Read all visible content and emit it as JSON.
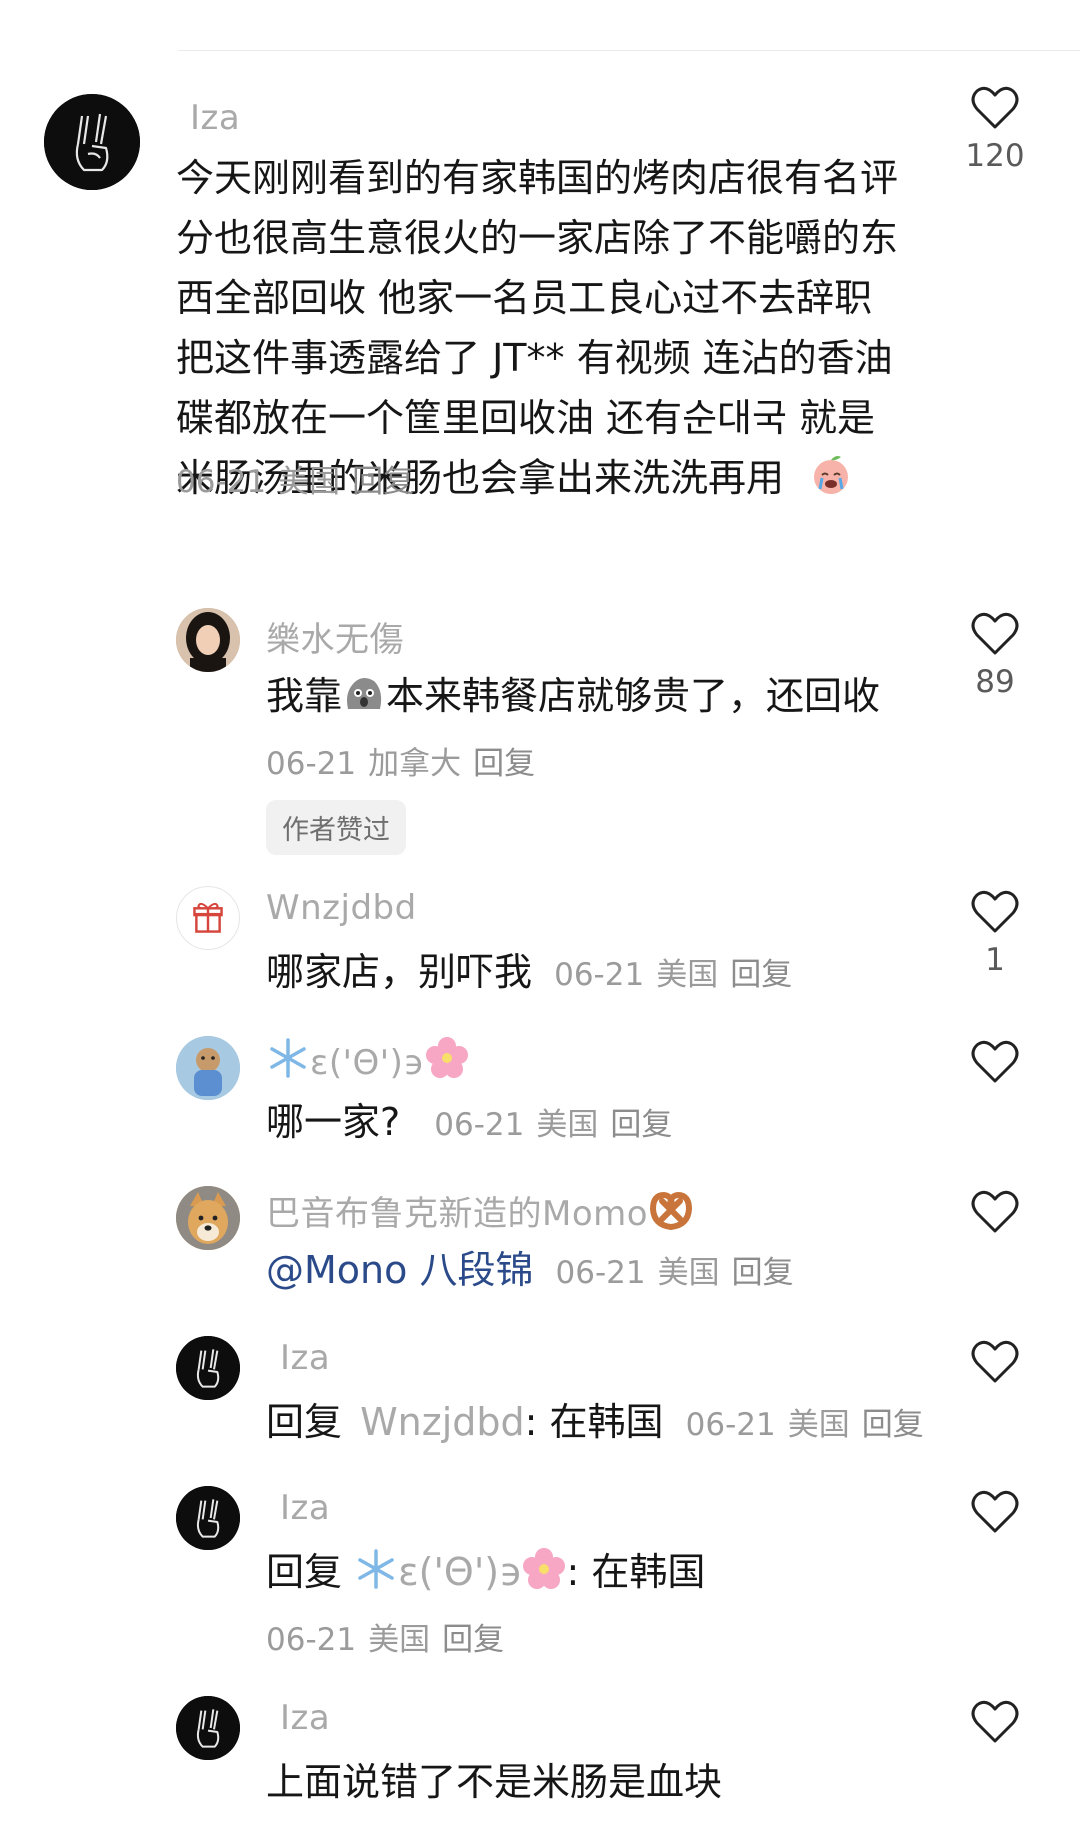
{
  "comments": [
    {
      "user": "Iza",
      "lines": [
        "今天刚刚看到的有家韩国的烤肉店很有名评",
        "分也很高生意很火的一家店除了不能嚼的东",
        "西全部回收 他家一名员工良心过不去辞职",
        "把这件事透露给了 JT** 有视频 连沾的香油",
        "碟都放在一个筐里回收油 还有순대국 就是",
        "米肠汤里的米肠也会拿出来洗洗再用"
      ],
      "date": "06-21",
      "location": "美国",
      "reply": "回复",
      "likes": "120"
    },
    {
      "user": "樂水无傷",
      "text_before": "我靠",
      "text_after": "本来韩餐店就够贵了，还回收",
      "date": "06-21",
      "location": "加拿大",
      "reply": "回复",
      "badge": "作者赞过",
      "likes": "89"
    },
    {
      "user": "Wnzjdbd",
      "text": "哪家店，别吓我",
      "date": "06-21",
      "location": "美国",
      "reply": "回复",
      "likes": "1"
    },
    {
      "user_mid": "ɛ('Θ')϶",
      "text": "哪一家?",
      "date": "06-21",
      "location": "美国",
      "reply": "回复"
    },
    {
      "user": "巴音布鲁克新造的Momo",
      "mention": "@Mono 八段锦",
      "date": "06-21",
      "location": "美国",
      "reply": "回复"
    },
    {
      "user": "Iza",
      "prefix": "回复",
      "reply_to": "Wnzjdbd",
      "text": ": 在韩国",
      "date": "06-21",
      "location": "美国",
      "reply": "回复"
    },
    {
      "user": "Iza",
      "prefix": "回复",
      "reply_to_mid": "ɛ('Θ')϶",
      "text": ": 在韩国",
      "date": "06-21",
      "location": "美国",
      "reply": "回复"
    },
    {
      "user": "Iza",
      "text": "上面说错了不是米肠是血块"
    }
  ],
  "icons": {
    "like": "heart-outline-icon",
    "avatar_iza": "peace-hand-icon",
    "avatar_gift": "gift-icon",
    "emoji_cry": "crying-peach-emoji",
    "emoji_shock": "shocked-rock-emoji",
    "emoji_snow": "snowflake-emoji",
    "emoji_flower": "cherry-blossom-emoji",
    "emoji_pretzel": "pretzel-emoji"
  },
  "colors": {
    "username": "#a9a9a9",
    "text": "#161616",
    "meta": "#9b9b9b",
    "mention": "#2b4a8a",
    "badge_bg": "#f1f1f1"
  }
}
